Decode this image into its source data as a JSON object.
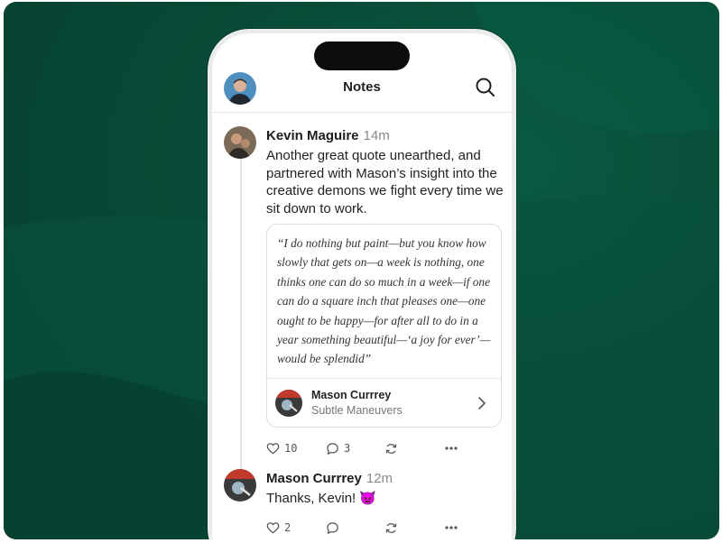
{
  "header": {
    "title": "Notes"
  },
  "posts": [
    {
      "author": "Kevin Maguire",
      "time": "14m",
      "body": "Another great quote unearthed, and partnered with Mason’s insight into the creative demons we fight every time we sit down to work.",
      "quote": {
        "text": "“I do nothing but paint—but you know how slowly that gets on—a week is nothing, one thinks one can do so much in a week—if one can do a square inch that pleases one—one ought to be happy—for after all to do in a year something beautiful—‘a joy for ever’—would be splendid”",
        "author": "Mason Currrey",
        "publication": "Subtle Maneuvers"
      },
      "likes": "10",
      "comments": "3"
    },
    {
      "author": "Mason Currrey",
      "time": "12m",
      "body": "Thanks, Kevin! 😈",
      "likes": "2",
      "comments": ""
    }
  ],
  "icons": {
    "search": "search-icon",
    "like": "heart-icon",
    "comment": "comment-icon",
    "restack": "restack-icon",
    "more": "more-icon",
    "chevron": "chevron-right-icon"
  },
  "colors": {
    "background": "#084a37",
    "text": "#1d1d1d",
    "muted": "#8a8a8a"
  }
}
